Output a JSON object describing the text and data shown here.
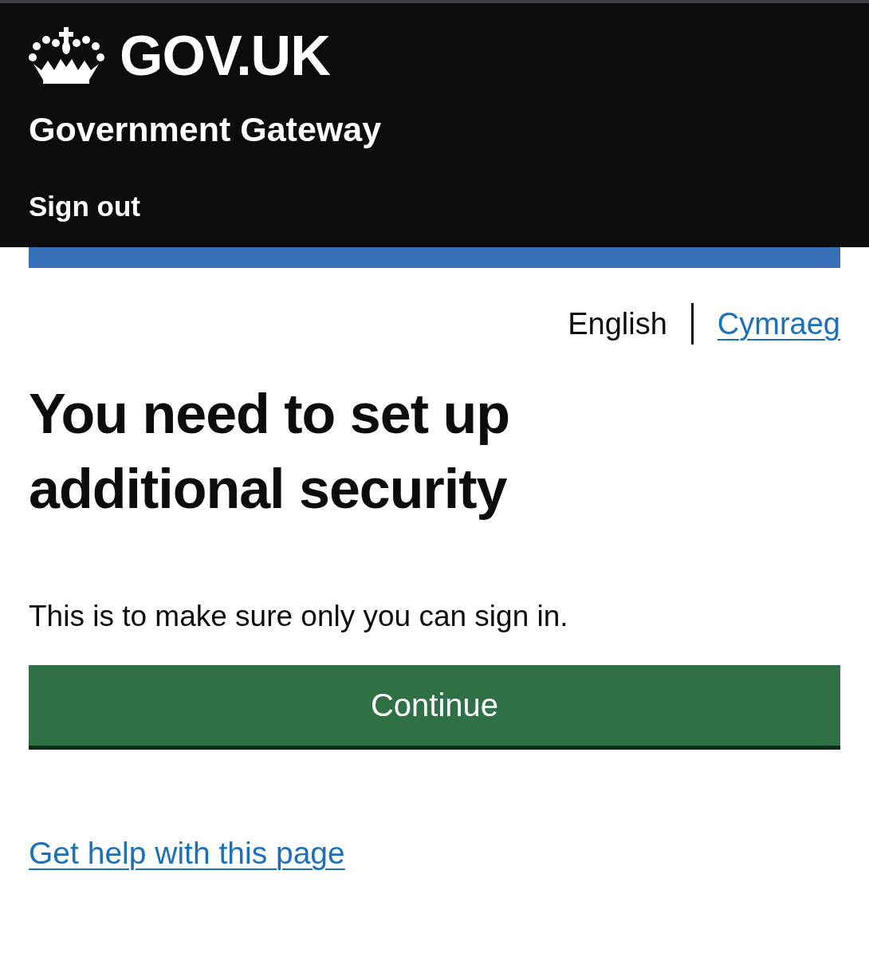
{
  "header": {
    "logo_text": "GOV.UK",
    "service_name": "Government Gateway",
    "nav_link": "Sign out"
  },
  "languages": [
    {
      "label": "English",
      "selected": true
    },
    {
      "label": "Cymraeg",
      "selected": false
    }
  ],
  "heading": "You need to set up additional security",
  "body": "This is to make sure only you can sign in.",
  "button": "Continue",
  "help_link": "Get help with this page"
}
